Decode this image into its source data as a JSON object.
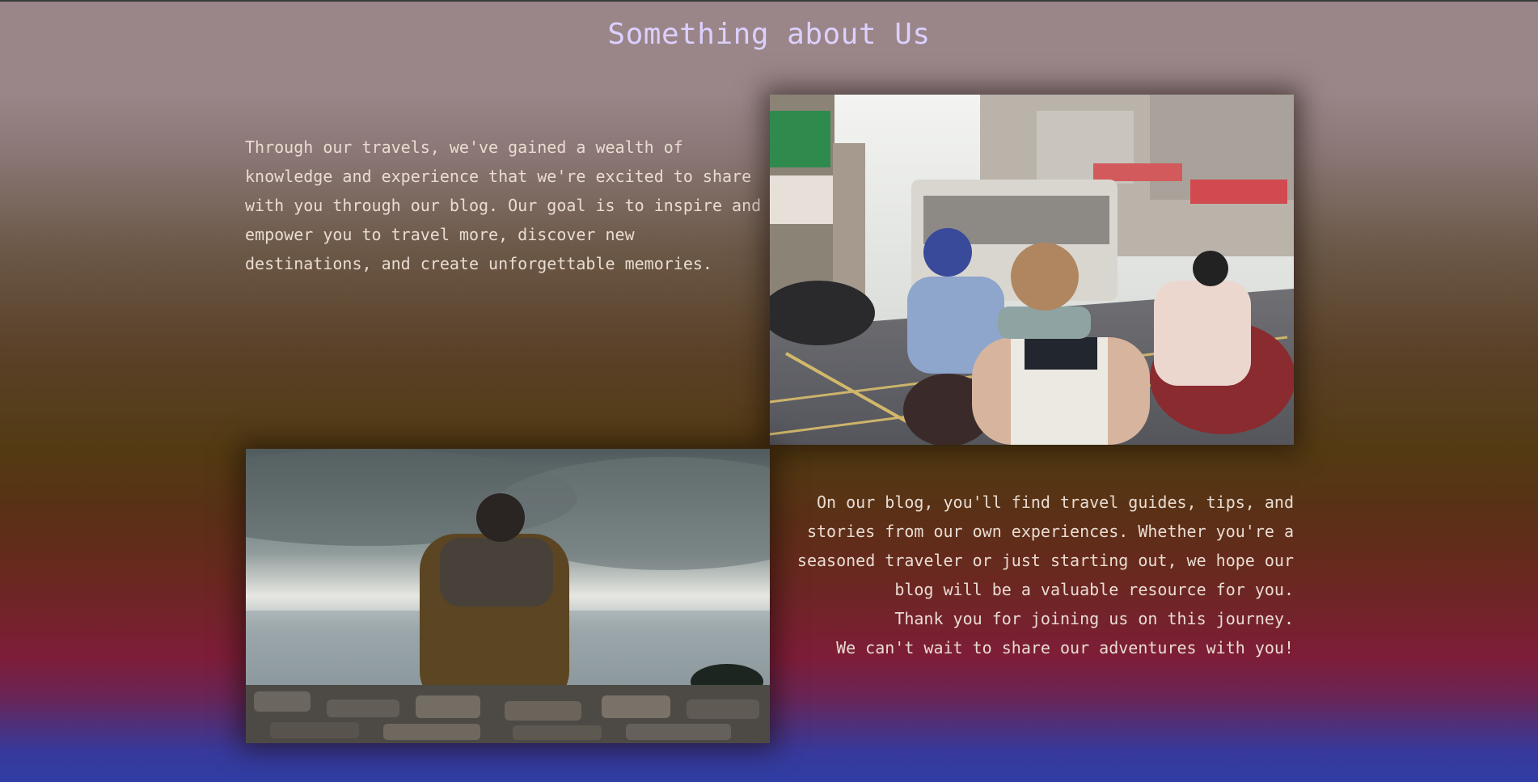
{
  "page": {
    "title": "Something about Us"
  },
  "section_top": {
    "text": "Through our travels, we've gained a wealth of knowledge and experience that we're excited to share with you through our blog. Our goal is to inspire and empower you to travel more, discover new destinations, and create unforgettable memories."
  },
  "section_bottom": {
    "line1": "On our blog, you'll find travel guides, tips, and stories from our own experiences. Whether you're a seasoned traveler or just starting out, we hope our blog will be a valuable resource for you.",
    "line2": "Thank you for joining us on this journey.",
    "line3": "We can't wait to share our adventures with you!"
  },
  "colors": {
    "title": "#dcd0ff",
    "body_text": "#e9dcd2",
    "gradient_top": "#9a8588",
    "gradient_mid": "#533a12",
    "gradient_bottom": "#2f3ea4"
  }
}
